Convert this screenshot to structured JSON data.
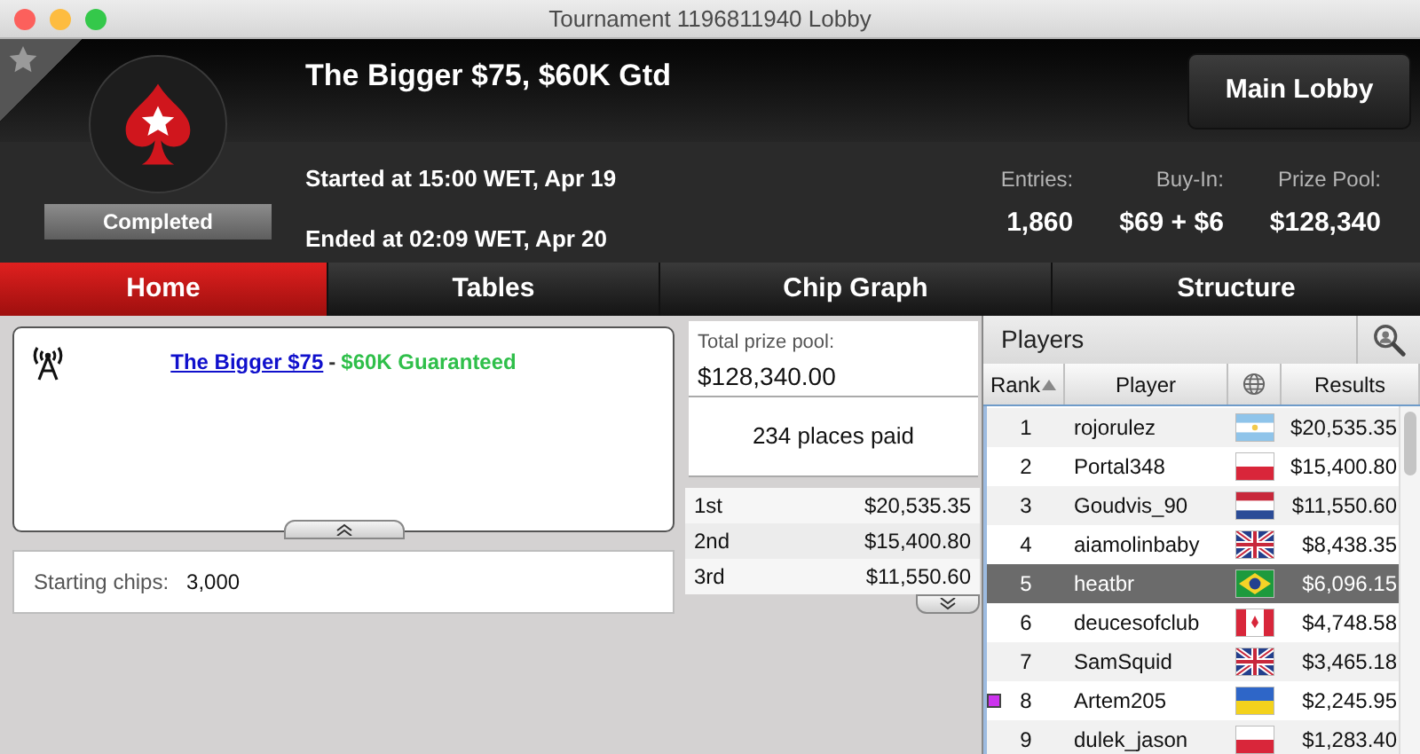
{
  "window": {
    "title": "Tournament 1196811940 Lobby"
  },
  "header": {
    "title": "The Bigger $75, $60K Gtd",
    "status": "Completed",
    "started": "Started at 15:00 WET, Apr 19",
    "ended": "Ended at 02:09 WET, Apr 20",
    "main_lobby_button": "Main Lobby",
    "stats": [
      {
        "label": "Entries:",
        "value": "1,860"
      },
      {
        "label": "Buy-In:",
        "value": "$69 + $6"
      },
      {
        "label": "Prize Pool:",
        "value": "$128,340"
      }
    ]
  },
  "tabs": [
    {
      "label": "Home",
      "selected": true
    },
    {
      "label": "Tables",
      "selected": false
    },
    {
      "label": "Chip Graph",
      "selected": false
    },
    {
      "label": "Structure",
      "selected": false
    }
  ],
  "news": {
    "link": "The Bigger $75",
    "separator": "-",
    "highlight": "$60K Guaranteed"
  },
  "info": {
    "label": "Starting chips:",
    "value": "3,000"
  },
  "prizes": {
    "total_label": "Total prize pool:",
    "total": "$128,340.00",
    "places_paid": "234 places paid",
    "rows": [
      {
        "place": "1st",
        "amount": "$20,535.35"
      },
      {
        "place": "2nd",
        "amount": "$15,400.80"
      },
      {
        "place": "3rd",
        "amount": "$11,550.60"
      }
    ]
  },
  "players": {
    "title": "Players",
    "columns": [
      {
        "label": "Rank",
        "sorted": true
      },
      {
        "label": "Player",
        "sorted": false
      },
      {
        "kind": "icon",
        "sorted": false
      },
      {
        "label": "Results",
        "sorted": false
      }
    ],
    "rows": [
      {
        "rank": "1",
        "player": "rojorulez",
        "kind": "argentina",
        "result": "$20,535.35",
        "selected": false
      },
      {
        "rank": "2",
        "player": "Portal348",
        "kind": "poland",
        "result": "$15,400.80",
        "selected": false
      },
      {
        "rank": "3",
        "player": "Goudvis_90",
        "kind": "netherlands",
        "result": "$11,550.60",
        "selected": false
      },
      {
        "rank": "4",
        "player": "aiamolinbaby",
        "kind": "uk",
        "result": "$8,438.35",
        "selected": false
      },
      {
        "rank": "5",
        "player": "heatbr",
        "kind": "brazil",
        "result": "$6,096.15",
        "selected": true
      },
      {
        "rank": "6",
        "player": "deucesofclub",
        "kind": "canada",
        "result": "$4,748.58",
        "selected": false
      },
      {
        "rank": "7",
        "player": "SamSquid",
        "kind": "uk",
        "result": "$3,465.18",
        "selected": false
      },
      {
        "rank": "8",
        "player": "Artem205",
        "kind": "ukraine",
        "result": "$2,245.95",
        "selected": false,
        "color": "#cc33ee"
      },
      {
        "rank": "9",
        "player": "dulek_jason",
        "kind": "poland",
        "result": "$1,283.40",
        "selected": false
      }
    ]
  }
}
